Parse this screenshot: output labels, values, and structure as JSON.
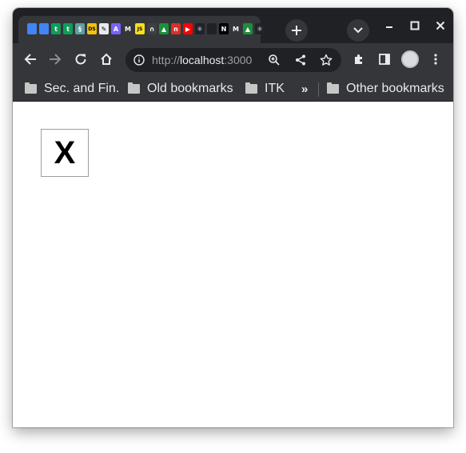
{
  "tabs": {
    "favicons": [
      {
        "icon": "docs-icon",
        "color": "#4285f4",
        "glyph": ""
      },
      {
        "icon": "docs-icon",
        "color": "#4285f4",
        "glyph": ""
      },
      {
        "icon": "sheets-icon",
        "color": "#0f9d58",
        "glyph": "t"
      },
      {
        "icon": "sheets-icon",
        "color": "#0f9d58",
        "glyph": "t"
      },
      {
        "icon": "spiral-icon",
        "color": "#5f9ea0",
        "glyph": "§"
      },
      {
        "icon": "ds-icon",
        "color": "#f4c20d",
        "glyph": "DS"
      },
      {
        "icon": "pen-icon",
        "color": "#e8eaed",
        "glyph": "✎"
      },
      {
        "icon": "a-icon",
        "color": "#7b61ff",
        "glyph": "A"
      },
      {
        "icon": "m-icon",
        "color": "#35363a",
        "glyph": "M"
      },
      {
        "icon": "js-icon",
        "color": "#f7df1e",
        "glyph": "JS"
      },
      {
        "icon": "arch-icon",
        "color": "#3c4043",
        "glyph": "∩"
      },
      {
        "icon": "drive-icon",
        "color": "#1e8e3e",
        "glyph": "▲"
      },
      {
        "icon": "n-icon",
        "color": "#d93025",
        "glyph": "n"
      },
      {
        "icon": "youtube-icon",
        "color": "#ff0000",
        "glyph": "▶"
      },
      {
        "icon": "react-icon",
        "color": "#20232a",
        "glyph": "⚛"
      },
      {
        "icon": "blank-icon",
        "color": "#202124",
        "glyph": ""
      },
      {
        "icon": "n-icon",
        "color": "#000000",
        "glyph": "N"
      },
      {
        "icon": "m-icon",
        "color": "#35363a",
        "glyph": "M"
      },
      {
        "icon": "drive-icon",
        "color": "#1e8e3e",
        "glyph": "▲"
      },
      {
        "icon": "react-icon",
        "color": "#20232a",
        "glyph": "⚛"
      }
    ]
  },
  "toolbar": {
    "url_scheme": "http://",
    "url_host": "localhost",
    "url_port": ":3000"
  },
  "bookmarks": {
    "items": [
      {
        "label": "Sec. and Fin."
      },
      {
        "label": "Old bookmarks"
      },
      {
        "label": "ITK"
      }
    ],
    "overflow": "»",
    "other": "Other bookmarks"
  },
  "page": {
    "button_label": "X"
  }
}
